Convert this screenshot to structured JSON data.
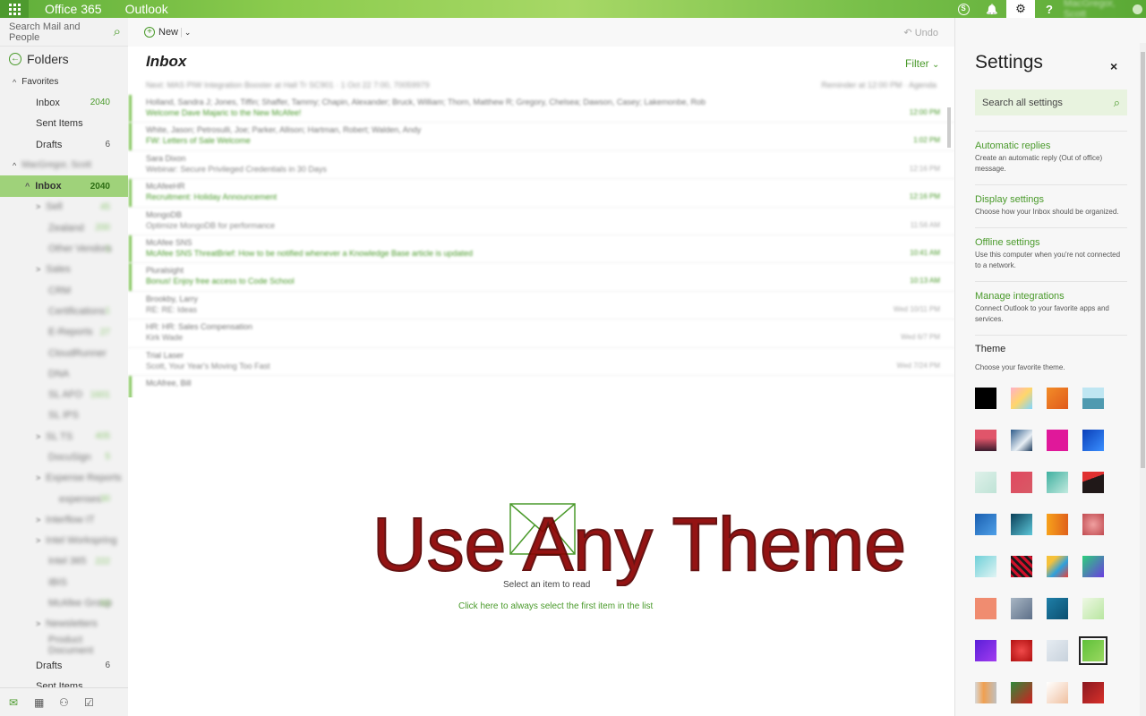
{
  "topbar": {
    "brand": "Office 365",
    "app": "Outlook",
    "skype_glyph": "S",
    "bell_glyph": "🔔",
    "gear_glyph": "⚙",
    "help_glyph": "?",
    "user_name": "MacGregor, Scott"
  },
  "leftnav": {
    "search_placeholder": "Search Mail and People",
    "folders_label": "Folders",
    "favorites_label": "Favorites",
    "favorites": [
      {
        "label": "Inbox",
        "count": "2040"
      },
      {
        "label": "Sent Items",
        "count": ""
      },
      {
        "label": "Drafts",
        "count": "6"
      }
    ],
    "account_label": "MacGregor, Scott",
    "inbox": {
      "label": "Inbox",
      "count": "2040"
    },
    "subfolders": [
      {
        "label": "Sell",
        "count": "45"
      },
      {
        "label": "Zealand",
        "count": "200"
      },
      {
        "label": "Other Vendors",
        "count": "1"
      },
      {
        "label": "Sales",
        "count": ""
      },
      {
        "label": "CRM",
        "count": ""
      },
      {
        "label": "Certifications",
        "count": "1"
      },
      {
        "label": "E-Reports",
        "count": "27"
      },
      {
        "label": "CloudRunner",
        "count": ""
      },
      {
        "label": "DNA",
        "count": ""
      },
      {
        "label": "SL AFO",
        "count": "1601"
      },
      {
        "label": "SL IPS",
        "count": ""
      },
      {
        "label": "SL TS",
        "count": "405"
      },
      {
        "label": "DocuSign",
        "count": "5"
      },
      {
        "label": "Expense Reports",
        "count": ""
      },
      {
        "label": "expenses",
        "count": "30"
      },
      {
        "label": "Interflow IT",
        "count": ""
      },
      {
        "label": "Intel Workspring",
        "count": ""
      },
      {
        "label": "Intel 365",
        "count": "222"
      },
      {
        "label": "IBIS",
        "count": ""
      },
      {
        "label": "McAfee Group",
        "count": "93"
      },
      {
        "label": "Newsletters",
        "count": ""
      },
      {
        "label": "Product Document",
        "count": ""
      }
    ],
    "bottom_folders": [
      {
        "label": "Drafts",
        "count": "6"
      },
      {
        "label": "Sent Items",
        "count": ""
      }
    ]
  },
  "cmdbar": {
    "new_label": "New",
    "undo_label": "Undo"
  },
  "list": {
    "title": "Inbox",
    "filter_label": "Filter",
    "meta_text": "Next: MAS PIW Integration Booster at Hall Tr SC901 · 1 Oct 22 7:00, 70059979",
    "meta_right": "Reminder at 12:00 PM · Agenda",
    "messages": [
      {
        "from": "Holland, Sandra J; Jones, Tiffin; Shaffer, Tammy; Chapin, Alexander; Bruck, William; Thorn, Matthew R; Gregory, Chelsea; Dawson, Casey; Lakemonbe, Rob",
        "subject": "Welcome Dave Majaric to the New McAfee!",
        "time": "12:00 PM",
        "unread": true
      },
      {
        "from": "White, Jason; Petrosulli, Joe; Parker, Allison; Hartman, Robert; Walden, Andy",
        "subject": "FW: Letters of Sale Welcome",
        "time": "1:02 PM",
        "unread": true
      },
      {
        "from": "Sara Dixon",
        "subject": "Webinar: Secure Privileged Credentials in 30 Days",
        "time": "12:16 PM",
        "unread": false
      },
      {
        "from": "McAfeeHR",
        "subject": "Recruitment: Holiday Announcement",
        "time": "12:16 PM",
        "unread": true
      },
      {
        "from": "MongoDB",
        "subject": "Optimize MongoDB for performance",
        "time": "11:56 AM",
        "unread": false
      },
      {
        "from": "McAfee SNS",
        "subject": "McAfee SNS ThreatBrief: How to be notified whenever a Knowledge Base article is updated",
        "time": "10:41 AM",
        "unread": true
      },
      {
        "from": "Pluralsight",
        "subject": "Bonus! Enjoy free access to Code School",
        "time": "10:13 AM",
        "unread": true
      },
      {
        "from": "Brookby, Larry",
        "subject": "RE: RE: Ideas",
        "time": "Wed 10/11 PM",
        "unread": false
      },
      {
        "from": "HR: HR: Sales Compensation",
        "subject": "Kirk Wade",
        "time": "Wed 6/7 PM",
        "unread": false
      },
      {
        "from": "Trial Laser",
        "subject": "Scott, Your Year's Moving Too Fast",
        "time": "Wed 7/24 PM",
        "unread": false
      },
      {
        "from": "McAfree, Bill",
        "subject": "",
        "time": "",
        "unread": true
      }
    ]
  },
  "reading": {
    "overlay": "Use Any Theme",
    "select_text": "Select an item to read",
    "first_item_link": "Click here to always select the first item in the list"
  },
  "settings": {
    "title": "Settings",
    "close_glyph": "×",
    "search_placeholder": "Search all settings",
    "sections": [
      {
        "title": "Automatic replies",
        "desc": "Create an automatic reply (Out of office) message."
      },
      {
        "title": "Display settings",
        "desc": "Choose how your Inbox should be organized."
      },
      {
        "title": "Offline settings",
        "desc": "Use this computer when you're not connected to a network."
      },
      {
        "title": "Manage integrations",
        "desc": "Connect Outlook to your favorite apps and services."
      }
    ],
    "theme_title": "Theme",
    "theme_subtitle": "Choose your favorite theme.",
    "themes": [
      {
        "bg": "#000000"
      },
      {
        "bg": "linear-gradient(135deg,#ffb0c8,#ffd66b,#7fd6ff)"
      },
      {
        "bg": "linear-gradient(135deg,#f28c28,#e05a1c)"
      },
      {
        "bg": "linear-gradient(180deg,#bfe6f2 50%,#4f9ab0 50%)"
      },
      {
        "bg": "linear-gradient(180deg,#e0556a 40%,#3b1c2e 100%)"
      },
      {
        "bg": "linear-gradient(135deg,#2e5b8a,#e7eef4 60%,#1d3b5c)"
      },
      {
        "bg": "#e0189a"
      },
      {
        "bg": "linear-gradient(135deg,#0a3fb8,#3a8fff)"
      },
      {
        "bg": "linear-gradient(135deg,#dff1ea,#bfe3d6)"
      },
      {
        "bg": "linear-gradient(135deg,#e04860,#d85a66)"
      },
      {
        "bg": "linear-gradient(135deg,#3fb0a0,#c2eadf)"
      },
      {
        "bg": "linear-gradient(160deg,#e03030 35%,#201818 35%)"
      },
      {
        "bg": "linear-gradient(135deg,#1a5fb0,#4fa0e8)"
      },
      {
        "bg": "linear-gradient(135deg,#0a3f58,#5cc6d8)"
      },
      {
        "bg": "linear-gradient(90deg,#f7a21b,#e0611b)"
      },
      {
        "bg": "radial-gradient(circle,#f0a0a0,#c04a50)"
      },
      {
        "bg": "linear-gradient(135deg,#6fd0d8,#e0f4f4)"
      },
      {
        "bg": "repeating-linear-gradient(45deg,#d0102a 0 3px,#1a1a1a 3px 6px)"
      },
      {
        "bg": "linear-gradient(135deg,#f5c13a 25%,#2fa0dc 60%,#e8403a)"
      },
      {
        "bg": "linear-gradient(135deg,#2ccf7b,#6a3ce0)"
      },
      {
        "bg": "#f08c70"
      },
      {
        "bg": "linear-gradient(135deg,#a8b6c4,#5d6f88)"
      },
      {
        "bg": "linear-gradient(135deg,#1f7fa8,#0a4f70)"
      },
      {
        "bg": "linear-gradient(135deg,#eef8e4,#b8e6a0)"
      },
      {
        "bg": "linear-gradient(135deg,#5a1fd8,#a23cf0)"
      },
      {
        "bg": "radial-gradient(circle,#f04a4a,#b01010)"
      },
      {
        "bg": "linear-gradient(135deg,#e6ecf2,#c8d2dc)"
      },
      {
        "bg": "linear-gradient(135deg,#5fc03a,#9ad860)",
        "selected": true
      },
      {
        "bg": "linear-gradient(90deg,#d8d8d8,#f0a050 40%,#c0c0c0)"
      },
      {
        "bg": "linear-gradient(135deg,#2f8a3a,#d02020)"
      },
      {
        "bg": "linear-gradient(135deg,#ffffff,#f0c0a0)"
      },
      {
        "bg": "linear-gradient(135deg,#8a1820,#d8302a)"
      }
    ]
  }
}
